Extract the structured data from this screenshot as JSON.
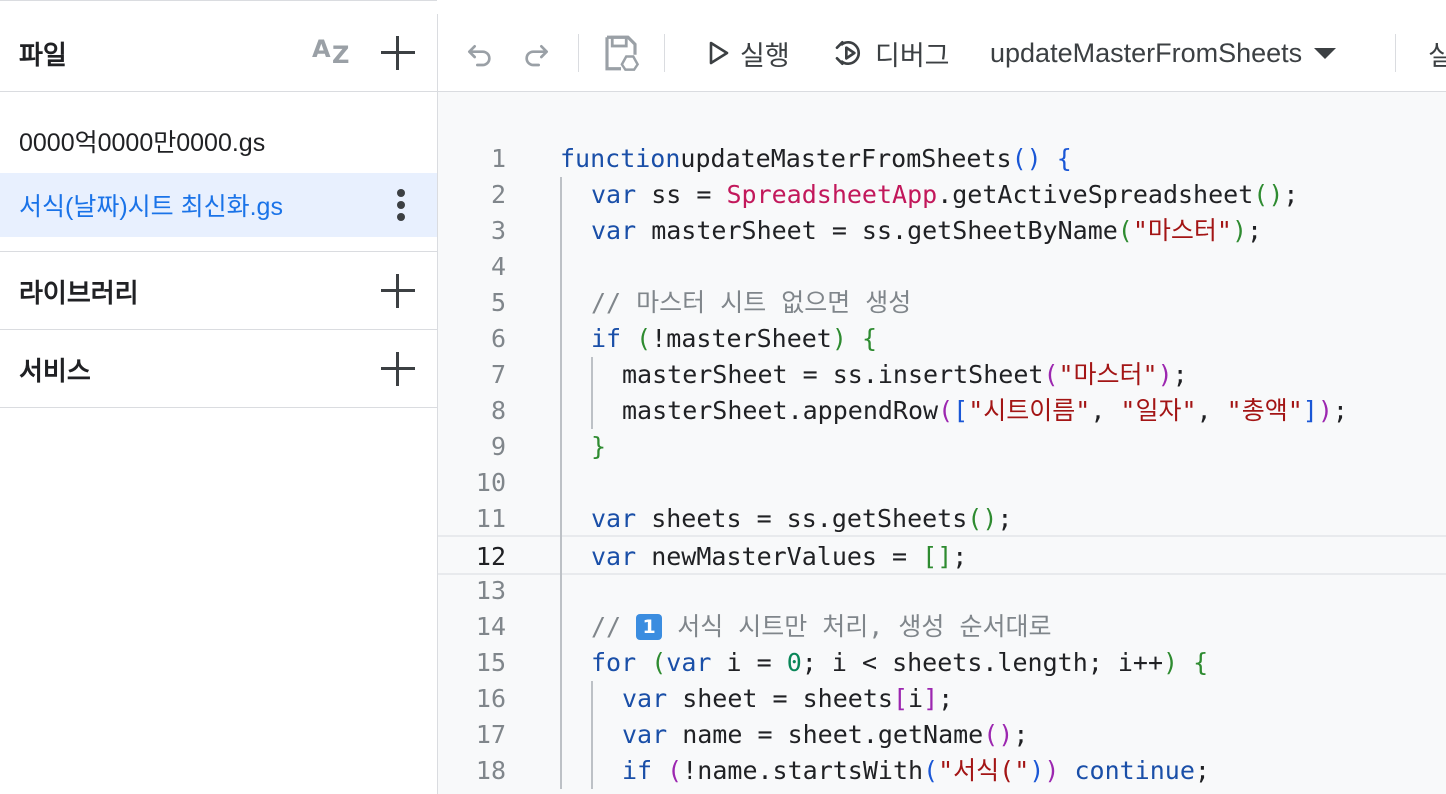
{
  "sidebar": {
    "files_title": "파일",
    "sort_icon_text": {
      "a": "A",
      "z": "Z"
    },
    "files": [
      {
        "name": "0000억0000만0000.gs",
        "active": false
      },
      {
        "name": "서식(날짜)시트 최신화.gs",
        "active": true
      }
    ],
    "libraries_title": "라이브러리",
    "services_title": "서비스"
  },
  "toolbar": {
    "run_label": "실행",
    "debug_label": "디버그",
    "function_select": "updateMasterFromSheets",
    "cutoff_label": "실"
  },
  "editor": {
    "current_line": 12,
    "lines": [
      {
        "n": "1",
        "indent": 0,
        "tokens": [
          [
            "kw",
            "function"
          ],
          [
            "",
            "updateMasterFromSheets"
          ],
          [
            "p1",
            "()"
          ],
          [
            "",
            " "
          ],
          [
            "p1",
            "{"
          ]
        ]
      },
      {
        "n": "2",
        "indent": 1,
        "tokens": [
          [
            "kw",
            "var"
          ],
          [
            "",
            " ss = "
          ],
          [
            "cls",
            "SpreadsheetApp"
          ],
          [
            "",
            ".getActiveSpreadsheet"
          ],
          [
            "p2",
            "()"
          ],
          [
            "",
            ";"
          ]
        ]
      },
      {
        "n": "3",
        "indent": 1,
        "tokens": [
          [
            "kw",
            "var"
          ],
          [
            "",
            " masterSheet = ss.getSheetByName"
          ],
          [
            "p2",
            "("
          ],
          [
            "str",
            "\"마스터\""
          ],
          [
            "p2",
            ")"
          ],
          [
            "",
            ";"
          ]
        ]
      },
      {
        "n": "4",
        "indent": 0,
        "tokens": []
      },
      {
        "n": "5",
        "indent": 1,
        "tokens": [
          [
            "cmt",
            "// 마스터 시트 없으면 생성"
          ]
        ]
      },
      {
        "n": "6",
        "indent": 1,
        "tokens": [
          [
            "kw",
            "if"
          ],
          [
            "",
            " "
          ],
          [
            "p2",
            "("
          ],
          [
            "",
            "!masterSheet"
          ],
          [
            "p2",
            ")"
          ],
          [
            "",
            " "
          ],
          [
            "p2",
            "{"
          ]
        ]
      },
      {
        "n": "7",
        "indent": 2,
        "tokens": [
          [
            "",
            "masterSheet = ss.insertSheet"
          ],
          [
            "p3",
            "("
          ],
          [
            "str",
            "\"마스터\""
          ],
          [
            "p3",
            ")"
          ],
          [
            "",
            ";"
          ]
        ]
      },
      {
        "n": "8",
        "indent": 2,
        "tokens": [
          [
            "",
            "masterSheet.appendRow"
          ],
          [
            "p3",
            "("
          ],
          [
            "p1",
            "["
          ],
          [
            "str",
            "\"시트이름\""
          ],
          [
            "",
            ", "
          ],
          [
            "str",
            "\"일자\""
          ],
          [
            "",
            ", "
          ],
          [
            "str",
            "\"총액\""
          ],
          [
            "p1",
            "]"
          ],
          [
            "p3",
            ")"
          ],
          [
            "",
            ";"
          ]
        ]
      },
      {
        "n": "9",
        "indent": 1,
        "tokens": [
          [
            "p2",
            "}"
          ]
        ]
      },
      {
        "n": "10",
        "indent": 0,
        "tokens": []
      },
      {
        "n": "11",
        "indent": 1,
        "tokens": [
          [
            "kw",
            "var"
          ],
          [
            "",
            " sheets = ss.getSheets"
          ],
          [
            "p2",
            "()"
          ],
          [
            "",
            ";"
          ]
        ]
      },
      {
        "n": "12",
        "indent": 1,
        "tokens": [
          [
            "kw",
            "var"
          ],
          [
            "",
            " newMasterValues = "
          ],
          [
            "p2",
            "[]"
          ],
          [
            "",
            ";"
          ]
        ]
      },
      {
        "n": "13",
        "indent": 0,
        "tokens": []
      },
      {
        "n": "14",
        "indent": 1,
        "tokens": [
          [
            "cmt",
            "// "
          ],
          [
            "badge",
            "1"
          ],
          [
            "cmt",
            " 서식 시트만 처리, 생성 순서대로"
          ]
        ]
      },
      {
        "n": "15",
        "indent": 1,
        "tokens": [
          [
            "kw",
            "for"
          ],
          [
            "",
            " "
          ],
          [
            "p2",
            "("
          ],
          [
            "kw",
            "var"
          ],
          [
            "",
            " i = "
          ],
          [
            "num",
            "0"
          ],
          [
            "",
            "; i < sheets.length; i++"
          ],
          [
            "p2",
            ")"
          ],
          [
            "",
            " "
          ],
          [
            "p2",
            "{"
          ]
        ]
      },
      {
        "n": "16",
        "indent": 2,
        "tokens": [
          [
            "kw",
            "var"
          ],
          [
            "",
            " sheet = sheets"
          ],
          [
            "p3",
            "["
          ],
          [
            "",
            "i"
          ],
          [
            "p3",
            "]"
          ],
          [
            "",
            ";"
          ]
        ]
      },
      {
        "n": "17",
        "indent": 2,
        "tokens": [
          [
            "kw",
            "var"
          ],
          [
            "",
            " name = sheet.getName"
          ],
          [
            "p3",
            "()"
          ],
          [
            "",
            ";"
          ]
        ]
      },
      {
        "n": "18",
        "indent": 2,
        "tokens": [
          [
            "kw",
            "if"
          ],
          [
            "",
            " "
          ],
          [
            "p3",
            "("
          ],
          [
            "",
            "!name.startsWith"
          ],
          [
            "p1",
            "("
          ],
          [
            "str",
            "\"서식(\""
          ],
          [
            "p1",
            ")"
          ],
          [
            "p3",
            ")"
          ],
          [
            "",
            " "
          ],
          [
            "kw",
            "continue"
          ],
          [
            "",
            ";"
          ]
        ]
      }
    ]
  }
}
